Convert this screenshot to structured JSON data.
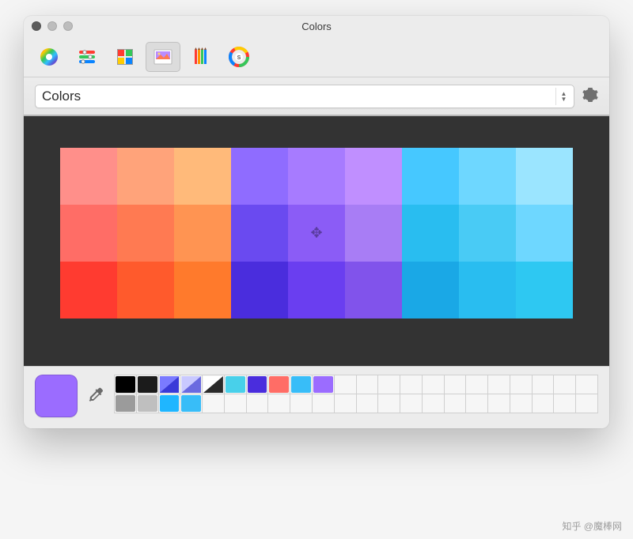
{
  "window": {
    "title": "Colors"
  },
  "toolbar": {
    "tabs": [
      {
        "name": "color-wheel-tab"
      },
      {
        "name": "color-sliders-tab"
      },
      {
        "name": "color-palettes-tab"
      },
      {
        "name": "image-palettes-tab"
      },
      {
        "name": "pencils-tab"
      },
      {
        "name": "spectrum-tab"
      }
    ],
    "selected_index": 3
  },
  "palette": {
    "dropdown_label": "Colors"
  },
  "image_swatches": [
    "#ff8f8a",
    "#ffa37a",
    "#ffba7a",
    "#8f6cff",
    "#a77bff",
    "#c08fff",
    "#46c8ff",
    "#6ed7ff",
    "#9be5ff",
    "#ff6d66",
    "#ff7a52",
    "#ff9452",
    "#6a4af0",
    "#8b5cf6",
    "#a87df5",
    "#29bdf0",
    "#49cbf5",
    "#6ed7ff",
    "#ff3b30",
    "#ff5a2c",
    "#ff7a2c",
    "#4a2ddd",
    "#6a3ef0",
    "#8153eb",
    "#1aa8e6",
    "#29bdf0",
    "#2ec8f2"
  ],
  "crosshair_index": 13,
  "current_color": "#9b6cff",
  "wells_row1": [
    {
      "solid": "#000000"
    },
    {
      "solid": "#1b1b1b"
    },
    {
      "split": [
        "#7a7aff",
        "#3a3ad8"
      ]
    },
    {
      "split": [
        "#c9c9ff",
        "#6a6ae0"
      ]
    },
    {
      "split": [
        "#ffffff",
        "#2a2a2a"
      ]
    },
    {
      "solid": "#48d0ea"
    },
    {
      "solid": "#4a2ddd"
    },
    {
      "solid": "#ff6d66"
    },
    {
      "solid": "#38bdf8"
    },
    {
      "solid": "#9b6cff"
    },
    null,
    null,
    null,
    null,
    null,
    null,
    null,
    null,
    null,
    null,
    null,
    null
  ],
  "wells_row2": [
    {
      "solid": "#9b9b9b"
    },
    {
      "solid": "#bfbfbf"
    },
    {
      "solid": "#1fb6ff"
    },
    {
      "solid": "#38bdf8"
    },
    null,
    null,
    null,
    null,
    null,
    null,
    null,
    null,
    null,
    null,
    null,
    null,
    null,
    null,
    null,
    null,
    null,
    null
  ],
  "watermark": "知乎 @魔棒网"
}
